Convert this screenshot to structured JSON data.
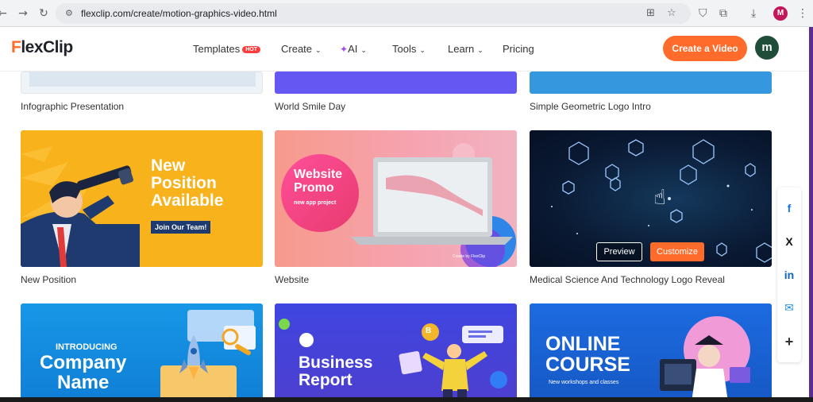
{
  "browser": {
    "back": "←",
    "forward": "→",
    "reload": "↻",
    "url": "flexclip.com/create/motion-graphics-video.html",
    "profile_initial": "M"
  },
  "header": {
    "logo_f": "F",
    "logo_rest": "lexClip",
    "nav": {
      "templates": "Templates",
      "hot": "HOT",
      "create": "Create",
      "ai": "AI",
      "tools": "Tools",
      "learn": "Learn",
      "pricing": "Pricing"
    },
    "cta": "Create a Video",
    "avatar_initial": "m"
  },
  "cards": {
    "row1": [
      "Infographic Presentation",
      "World Smile Day",
      "Simple Geometric Logo Intro"
    ],
    "row2": [
      "New Position",
      "Website",
      "Medical Science And Technology Logo Reveal"
    ]
  },
  "thumbs": {
    "new_position": {
      "line1": "New",
      "line2": "Position",
      "line3": "Available",
      "sub": "Join Our Team!"
    },
    "website": {
      "line1": "Website",
      "line2": "Promo",
      "sub": "new app project",
      "footer": "Create by FlexClip"
    },
    "medical": {
      "preview": "Preview",
      "customize": "Customize"
    },
    "company": {
      "small": "INTRODUCING",
      "line1": "Company",
      "line2": "Name"
    },
    "business": {
      "line1": "Business",
      "line2": "Report",
      "badge": "B"
    },
    "online": {
      "line1": "ONLINE",
      "line2": "COURSE",
      "sub": "New workshops and classes"
    }
  },
  "share": {
    "facebook": "f",
    "x": "X",
    "linkedin": "in",
    "email": "✉",
    "more": "+"
  },
  "colors": {
    "accent": "#ff6b2b",
    "avatar": "#1e4d3a",
    "hot": "#ff3d3d"
  }
}
